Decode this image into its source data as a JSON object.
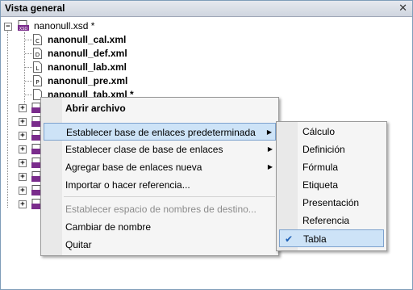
{
  "panel": {
    "title": "Vista general"
  },
  "tree": {
    "root": {
      "label": "nanonull.xsd *",
      "expander": "−"
    },
    "children": [
      {
        "letter": "C",
        "label": "nanonull_cal.xml"
      },
      {
        "letter": "D",
        "label": "nanonull_def.xml"
      },
      {
        "letter": "L",
        "label": "nanonull_lab.xml"
      },
      {
        "letter": "P",
        "label": "nanonull_pre.xml"
      },
      {
        "letter": "",
        "label": "nanonull_tab.xml *"
      }
    ],
    "collapsed_expander": "+"
  },
  "context_menu": {
    "items": [
      {
        "label": "Abrir archivo",
        "bold": true
      },
      {
        "label": "Establecer base de enlaces predeterminada",
        "submenu": true,
        "highlight": true
      },
      {
        "label": "Establecer clase de base de enlaces",
        "submenu": true
      },
      {
        "label": "Agregar base de enlaces nueva",
        "submenu": true
      },
      {
        "label": "Importar o hacer referencia..."
      },
      {
        "label": "Establecer espacio de nombres de destino...",
        "disabled": true
      },
      {
        "label": "Cambiar de nombre"
      },
      {
        "label": "Quitar"
      }
    ],
    "arrow": "▶"
  },
  "submenu": {
    "items": [
      {
        "label": "Cálculo"
      },
      {
        "label": "Definición"
      },
      {
        "label": "Fórmula"
      },
      {
        "label": "Etiqueta"
      },
      {
        "label": "Presentación"
      },
      {
        "label": "Referencia"
      },
      {
        "label": "Tabla",
        "checked": true,
        "highlight": true
      }
    ],
    "check": "✔"
  },
  "colors": {
    "accent_highlight": "#cde3f7",
    "icon_purple": "#7a2c8c",
    "check_blue": "#1c5fb5"
  }
}
